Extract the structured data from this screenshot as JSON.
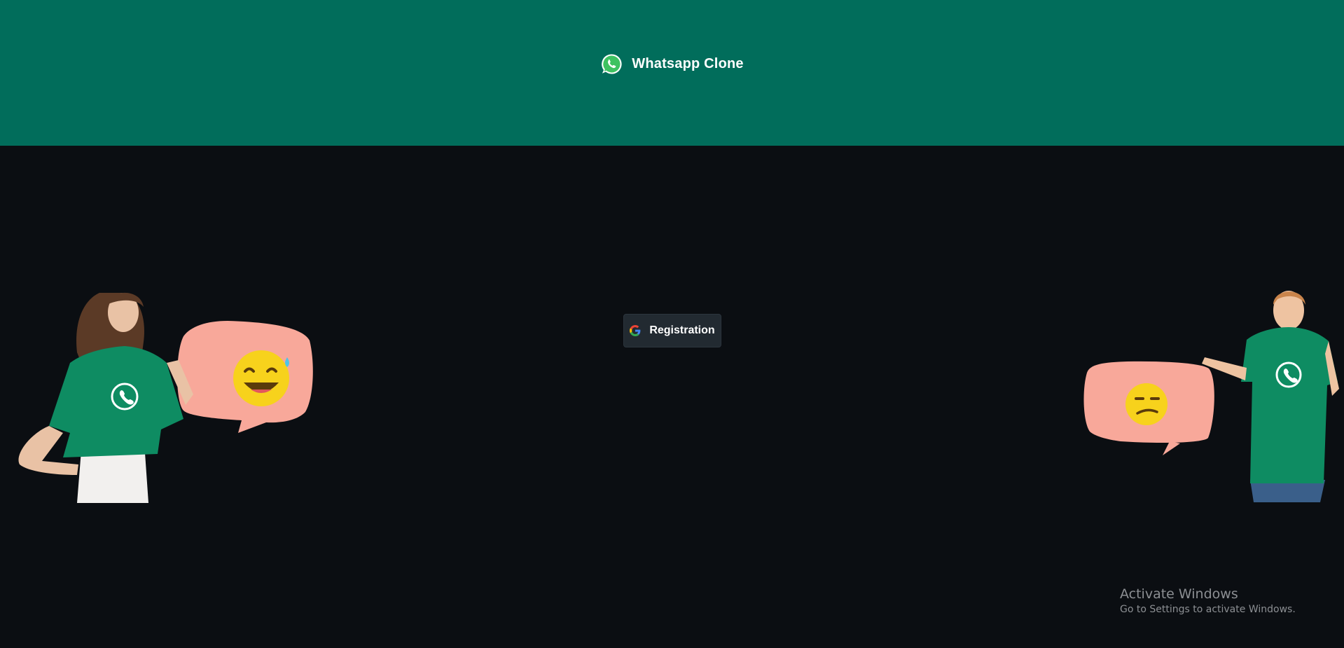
{
  "header": {
    "title": "Whatsapp Clone",
    "logo_icon": "whatsapp-logo-icon",
    "background": "#016d5b"
  },
  "main": {
    "background": "#0b0e12",
    "registration_button": {
      "label": "Registration",
      "icon": "google-icon"
    }
  },
  "illustrations": {
    "left": "woman-in-whatsapp-tshirt-holding-sweat-smile-emoji-bubble",
    "right": "man-in-whatsapp-tshirt-holding-confused-emoji-bubble"
  },
  "os_watermark": {
    "line1": "Activate Windows",
    "line2": "Go to Settings to activate Windows."
  },
  "colors": {
    "accent": "#016d5b",
    "bubble": "#f8a89a",
    "tshirt": "#0e8c62",
    "emoji": "#f7d21c"
  }
}
